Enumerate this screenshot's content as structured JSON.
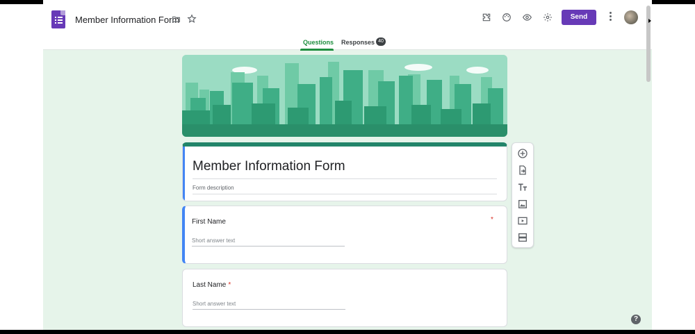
{
  "header": {
    "doc_title": "Member Information Form",
    "send_label": "Send",
    "icons": [
      "forms-logo-icon",
      "folder-icon",
      "star-icon",
      "addon-puzzle-icon",
      "palette-icon",
      "preview-eye-icon",
      "settings-gear-icon",
      "more-vert-icon",
      "avatar"
    ]
  },
  "tabs": {
    "questions": "Questions",
    "responses": "Responses",
    "responses_count": "40"
  },
  "form": {
    "title": "Member Information Form",
    "description_placeholder": "Form description"
  },
  "questions": [
    {
      "label": "First Name",
      "required_mark": "*",
      "answer_placeholder": "Short answer text"
    },
    {
      "label": "Last Name",
      "required_mark": "*",
      "answer_placeholder": "Short answer text"
    }
  ],
  "side_toolbar": [
    "add-question-icon",
    "import-questions-icon",
    "add-title-icon",
    "add-image-icon",
    "add-video-icon",
    "add-section-icon"
  ],
  "help": "?",
  "colors": {
    "accent": "#673ab7",
    "theme": "#22856a",
    "background": "#e6f4ea"
  }
}
